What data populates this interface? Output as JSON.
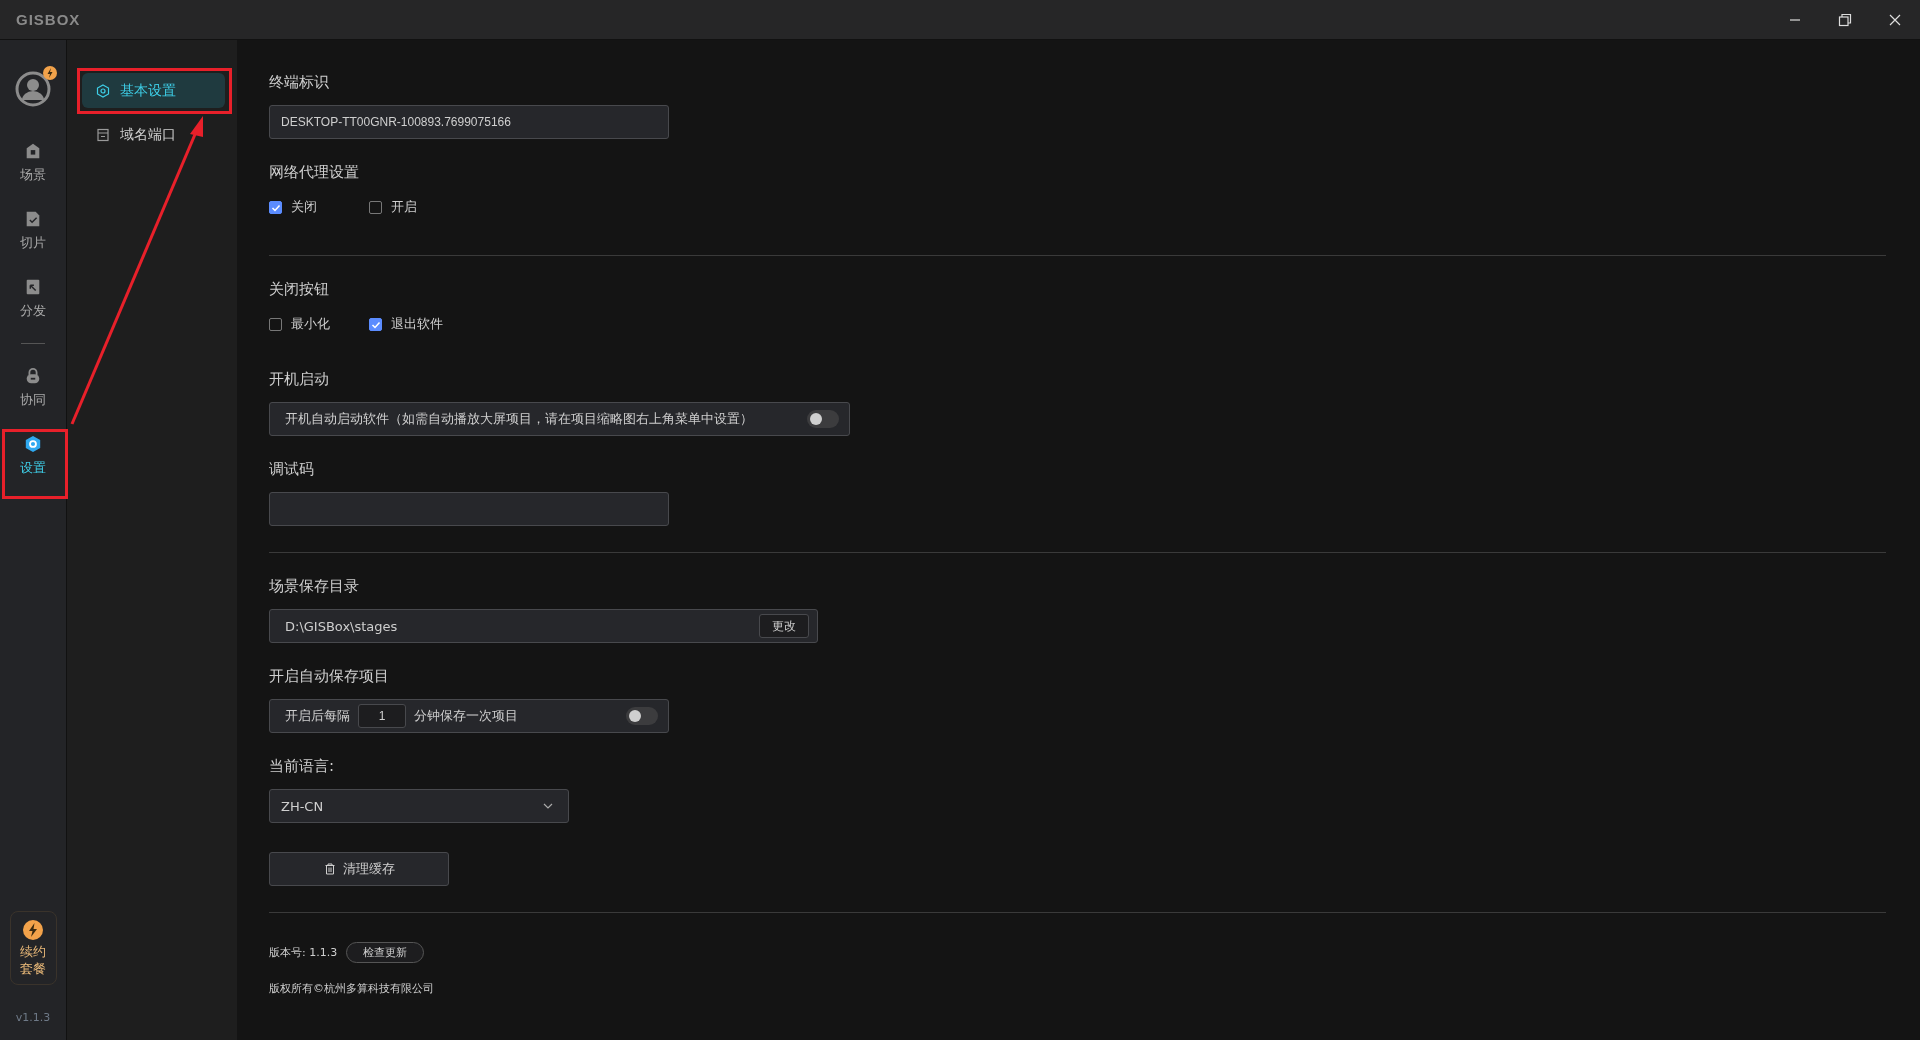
{
  "window": {
    "logo": "GISBOX"
  },
  "rail": {
    "avatar": {
      "badge": true
    },
    "items": [
      {
        "label": "场景",
        "selected": false
      },
      {
        "label": "切片",
        "selected": false
      },
      {
        "label": "分发",
        "selected": false
      },
      {
        "label": "协同",
        "selected": false
      },
      {
        "label": "设置",
        "selected": true
      }
    ],
    "renew": {
      "label": "续约套餐"
    },
    "version": "v1.1.3"
  },
  "submenu": [
    {
      "label": "基本设置",
      "selected": true
    },
    {
      "label": "域名端口",
      "selected": false
    }
  ],
  "annotations": [
    {
      "kind": "frame"
    },
    {
      "kind": "frame"
    },
    {
      "kind": "arrow"
    }
  ],
  "settings": {
    "terminal_id": {
      "label": "终端标识",
      "value": "DESKTOP-TT00GNR-100893.7699075166"
    },
    "proxy": {
      "label": "网络代理设置",
      "options": [
        {
          "label": "关闭",
          "checked": true
        },
        {
          "label": "开启",
          "checked": false
        }
      ]
    },
    "close_button": {
      "label": "关闭按钮",
      "options": [
        {
          "label": "最小化",
          "checked": false
        },
        {
          "label": "退出软件",
          "checked": true
        }
      ]
    },
    "autostart": {
      "label": "开机启动",
      "description": "开机自动启动软件（如需自动播放大屏项目，请在项目缩略图右上角菜单中设置）",
      "on": false
    },
    "debug_code": {
      "label": "调试码"
    },
    "save_dir": {
      "label": "场景保存目录",
      "value": "D:\\GISBox\\stages",
      "button": "更改"
    },
    "autosave": {
      "label": "开启自动保存项目",
      "prefix": "开启后每隔",
      "interval": "1",
      "suffix": "分钟保存一次项目",
      "on": false
    },
    "language": {
      "label": "当前语言:",
      "value": "ZH-CN"
    },
    "clear_cache": "清理缓存",
    "version": {
      "label": "版本号: 1.1.3",
      "button": "检查更新"
    },
    "copyright": "版权所有©杭州多算科技有限公司"
  }
}
